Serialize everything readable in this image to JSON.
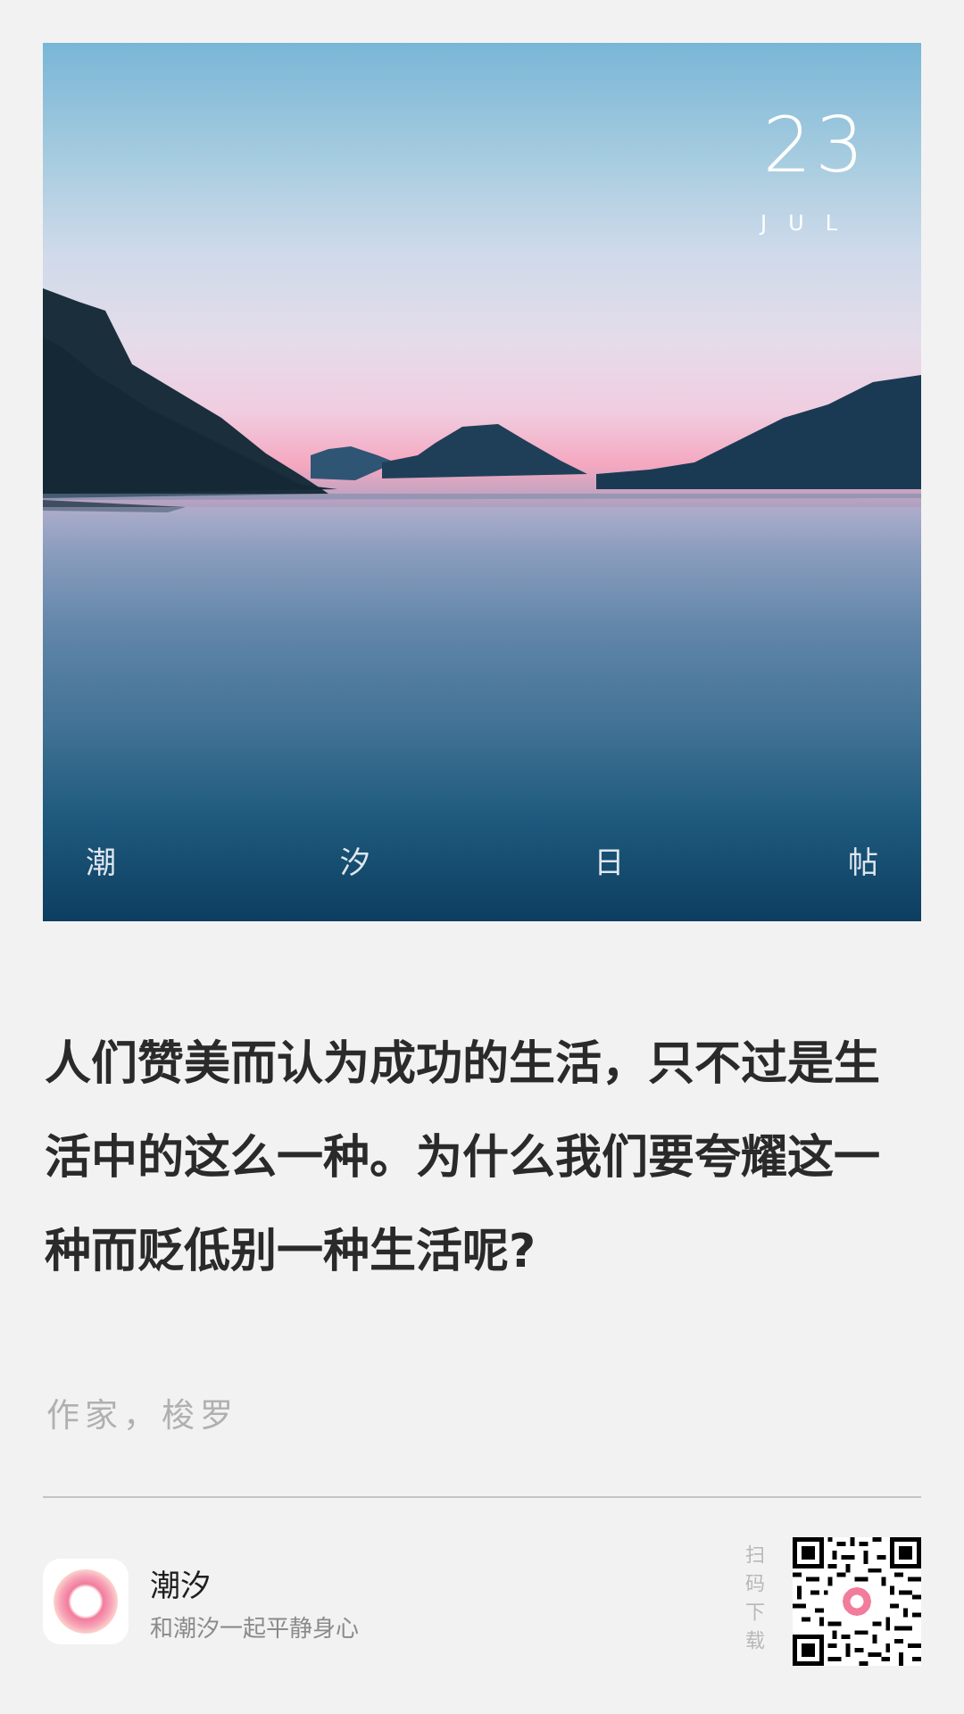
{
  "hero": {
    "date_day": "23",
    "date_month": "JUL",
    "caption": [
      "潮",
      "汐",
      "日",
      "帖"
    ]
  },
  "quote": {
    "text": "人们赞美而认为成功的生活，只不过是生活中的这么一种。为什么我们要夸耀这一种而贬低别一种生活呢?",
    "author": "作家，梭罗"
  },
  "footer": {
    "app_name": "潮汐",
    "app_tagline": "和潮汐一起平静身心",
    "scan_label": "扫码下载",
    "icons": {
      "app": "tide-app-icon",
      "qr": "qr-code"
    },
    "colors": {
      "brand_pink": "#f47a9a",
      "text_dark": "#2a2a2a",
      "muted": "#b0b0b0"
    }
  }
}
